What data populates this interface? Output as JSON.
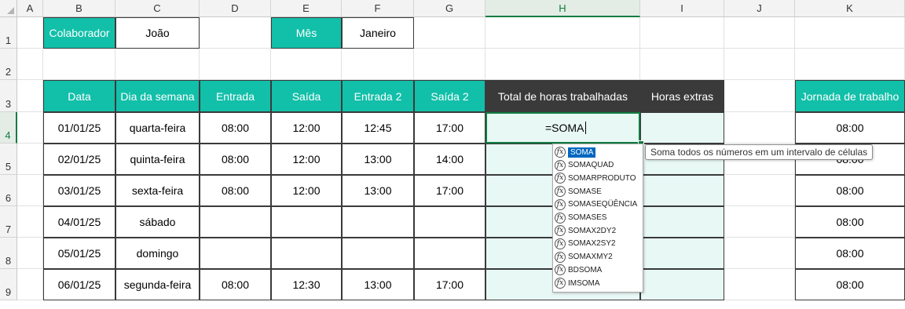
{
  "columns": [
    "A",
    "B",
    "C",
    "D",
    "E",
    "F",
    "G",
    "H",
    "I",
    "J",
    "K"
  ],
  "rows": [
    "1",
    "2",
    "3",
    "4",
    "5",
    "6",
    "7",
    "8",
    "9"
  ],
  "row1": {
    "colaborador_label": "Colaborador",
    "colaborador_value": "João",
    "mes_label": "Mês",
    "mes_value": "Janeiro"
  },
  "headers": [
    "Data",
    "Dia da semana",
    "Entrada",
    "Saída",
    "Entrada 2",
    "Saída 2",
    "Total de horas trabalhadas",
    "Horas extras"
  ],
  "jornada_header": "Jornada de trabalho",
  "table": [
    {
      "data": "01/01/25",
      "dia": "quarta-feira",
      "e1": "08:00",
      "s1": "12:00",
      "e2": "12:45",
      "s2": "17:00",
      "jornada": "08:00"
    },
    {
      "data": "02/01/25",
      "dia": "quinta-feira",
      "e1": "08:00",
      "s1": "12:00",
      "e2": "13:00",
      "s2": "14:00",
      "jornada": "08:00"
    },
    {
      "data": "03/01/25",
      "dia": "sexta-feira",
      "e1": "08:00",
      "s1": "12:00",
      "e2": "13:00",
      "s2": "17:00",
      "jornada": "08:00"
    },
    {
      "data": "04/01/25",
      "dia": "sábado",
      "e1": "",
      "s1": "",
      "e2": "",
      "s2": "",
      "jornada": "08:00"
    },
    {
      "data": "05/01/25",
      "dia": "domingo",
      "e1": "",
      "s1": "",
      "e2": "",
      "s2": "",
      "jornada": "08:00"
    },
    {
      "data": "06/01/25",
      "dia": "segunda-feira",
      "e1": "08:00",
      "s1": "12:30",
      "e2": "13:00",
      "s2": "17:00",
      "jornada": "08:00"
    }
  ],
  "active_cell": {
    "ref": "H4",
    "formula": "=SOMA"
  },
  "autocomplete": {
    "items": [
      "SOMA",
      "SOMAQUAD",
      "SOMARPRODUTO",
      "SOMASE",
      "SOMASEQÜÊNCIA",
      "SOMASES",
      "SOMAX2DY2",
      "SOMAX2SY2",
      "SOMAXMY2",
      "BDSOMA",
      "IMSOMA"
    ],
    "icon": "function-icon",
    "tooltip": "Soma todos os números em um intervalo de células"
  },
  "colors": {
    "teal": "#12bfa9",
    "dark_header": "#3a3a3a",
    "mint": "#e8f8f4",
    "selection": "#107c41",
    "highlight": "#0067c0"
  }
}
